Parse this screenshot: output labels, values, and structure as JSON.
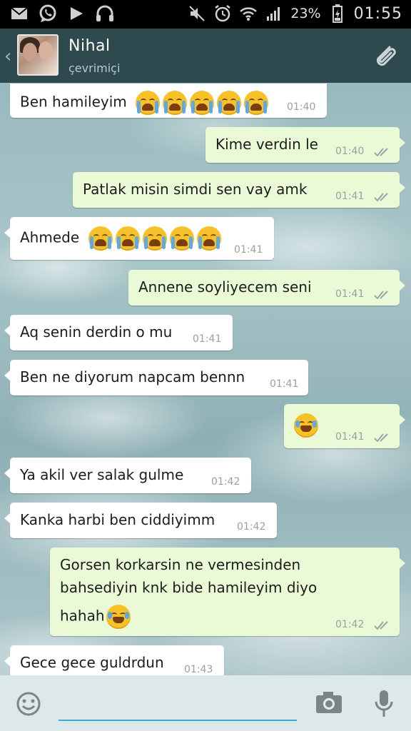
{
  "status_bar": {
    "battery_percent": "23%",
    "time": "01:55",
    "icons": [
      "mail-icon",
      "whatsapp-icon",
      "play-icon",
      "headphones-icon",
      "mute-icon",
      "alarm-icon",
      "wifi-icon",
      "signal-icon",
      "battery-icon"
    ]
  },
  "header": {
    "contact_name": "Nihal",
    "contact_status": "çevrimiçi",
    "icons": [
      "back-chevron-icon",
      "avatar",
      "paperclip-icon"
    ]
  },
  "messages": [
    {
      "dir": "in",
      "text": "Ben hamileyim",
      "emoji": [
        "crying-face",
        "crying-face",
        "crying-face",
        "crying-face",
        "crying-face"
      ],
      "time": "01:40"
    },
    {
      "dir": "out",
      "text": "Kime verdin le",
      "time": "01:40",
      "status": "read"
    },
    {
      "dir": "out",
      "text": "Patlak misin simdi sen vay amk",
      "time": "01:41",
      "status": "read"
    },
    {
      "dir": "in",
      "text": "Ahmede",
      "emoji": [
        "crying-face",
        "crying-face",
        "crying-face",
        "crying-face",
        "crying-face"
      ],
      "time": "01:41"
    },
    {
      "dir": "out",
      "text": "Annene soyliyecem seni",
      "time": "01:41",
      "status": "read"
    },
    {
      "dir": "in",
      "text": "Aq senin derdin o mu",
      "time": "01:41"
    },
    {
      "dir": "in",
      "text": "Ben ne diyorum napcam bennn",
      "time": "01:41"
    },
    {
      "dir": "out",
      "text": "",
      "emoji": [
        "laughing-tears-face"
      ],
      "time": "01:41",
      "status": "read"
    },
    {
      "dir": "in",
      "text": "Ya akil ver salak gulme",
      "time": "01:42"
    },
    {
      "dir": "in",
      "text": "Kanka harbi ben ciddiyimm",
      "time": "01:42"
    },
    {
      "dir": "out",
      "lines": [
        "Gorsen korkarsin ne vermesinden",
        "bahsediyin knk bide hamileyim diyo",
        "hahah"
      ],
      "emoji": [
        "laughing-tears-face"
      ],
      "time": "01:42",
      "status": "read"
    },
    {
      "dir": "in",
      "text": "Gece gece guldrdun",
      "time": "01:43"
    }
  ],
  "input_bar": {
    "placeholder": "",
    "icons": [
      "smiley-icon",
      "camera-icon",
      "microphone-icon"
    ]
  },
  "colors": {
    "header_bg": "#2f4a4f",
    "outgoing_bubble": "#eafad6",
    "incoming_bubble": "#ffffff",
    "input_underline": "#3aa9d4"
  }
}
